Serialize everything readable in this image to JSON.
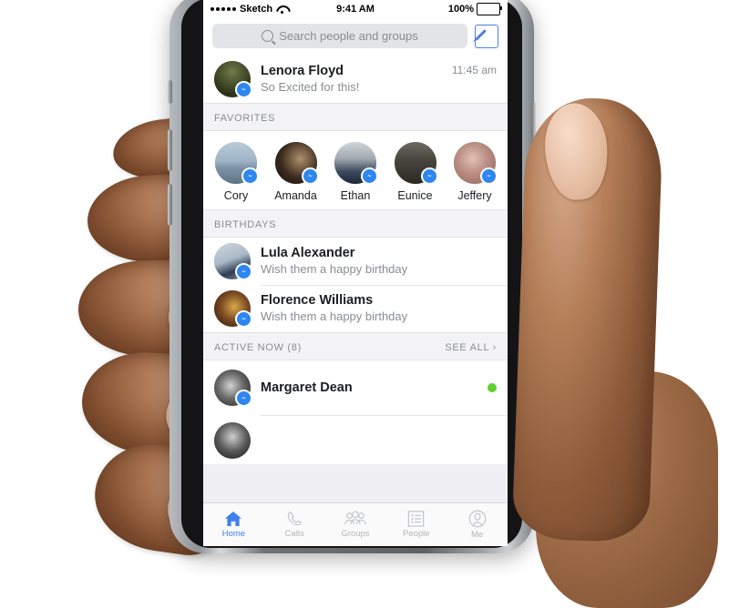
{
  "status_bar": {
    "carrier": "Sketch",
    "signal_dots": 5,
    "wifi_icon": "wifi-icon",
    "time": "9:41 AM",
    "battery_percent": "100%",
    "battery_level": 100
  },
  "search": {
    "placeholder": "Search people and groups",
    "search_icon": "search-icon",
    "compose_icon": "compose-icon"
  },
  "conversation": {
    "name": "Lenora Floyd",
    "preview": "So Excited for this!",
    "time": "11:45 am",
    "badge_icon": "messenger-badge-icon"
  },
  "favorites": {
    "title": "FAVORITES",
    "people": [
      {
        "name": "Cory"
      },
      {
        "name": "Amanda"
      },
      {
        "name": "Ethan"
      },
      {
        "name": "Eunice"
      },
      {
        "name": "Jeffery"
      }
    ]
  },
  "birthdays": {
    "title": "BIRTHDAYS",
    "people": [
      {
        "name": "Lula Alexander",
        "subtitle": "Wish them a happy birthday"
      },
      {
        "name": "Florence Williams",
        "subtitle": "Wish them a happy birthday"
      }
    ]
  },
  "active_now": {
    "title": "ACTIVE NOW (8)",
    "see_all": "SEE ALL ›",
    "people": [
      {
        "name": "Margaret Dean",
        "online": true
      }
    ]
  },
  "tab_bar": {
    "tabs": [
      {
        "label": "Home",
        "icon": "home-icon",
        "active": true
      },
      {
        "label": "Calls",
        "icon": "phone-icon",
        "active": false
      },
      {
        "label": "Groups",
        "icon": "groups-icon",
        "active": false
      },
      {
        "label": "People",
        "icon": "list-icon",
        "active": false
      },
      {
        "label": "Me",
        "icon": "person-icon",
        "active": false
      }
    ]
  },
  "colors": {
    "accent_blue": "#3f7ff0",
    "badge_blue": "#2e86f0",
    "online_green": "#5fcf2e",
    "section_bg": "#f3f3f5",
    "muted_text": "#8a8d91"
  }
}
